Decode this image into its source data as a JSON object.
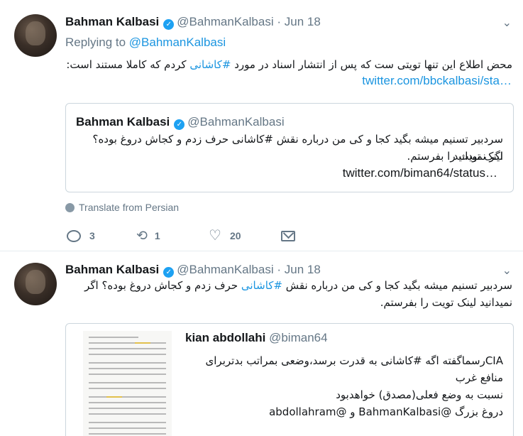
{
  "tweets": [
    {
      "name": "Bahman Kalbasi",
      "handle": "@BahmanKalbasi",
      "separator": "·",
      "date": "Jun 18",
      "replying_label": "Replying to",
      "replying_to": "@BahmanKalbasi",
      "text_before_hashtag": "محض اطلاع این تنها تویتی ست که پس از انتشار اسناد در مورد ",
      "hashtag": "#کاشانی",
      "text_after_hashtag": " کردم که کاملا مستند است:",
      "link": "twitter.com/bbckalbasi/sta…",
      "quote": {
        "name": "Bahman Kalbasi",
        "handle": "@BahmanKalbasi",
        "text_line1": "سردبیر تسنیم میشه بگید کجا و کی من درباره نقش #کاشانی حرف زدم و کجاش دروغ بوده؟ اگر نمیدانید",
        "text_line2": "لینک تویت را بفرستم.",
        "url": "twitter.com/biman64/status…"
      },
      "translate": "Translate from Persian",
      "actions": {
        "replies": "3",
        "retweets": "1",
        "likes": "20"
      }
    },
    {
      "name": "Bahman Kalbasi",
      "handle": "@BahmanKalbasi",
      "separator": "·",
      "date": "Jun 18",
      "text_before_hashtag": "سردبیر تسنیم میشه بگید کجا و کی من درباره نقش ",
      "hashtag": "#کاشانی",
      "text_after_hashtag": " حرف زدم و کجاش دروغ بوده؟ اگر نمیدانید لینک تویت را بفرستم.",
      "quote": {
        "name": "kian abdollahi",
        "handle": "@biman64",
        "text_line1": "CIAرسماگفته اگه #کاشانی به قدرت برسد،وضعی بمراتب بدتربرای منافع غرب",
        "text_line2": "نسبت به وضع فعلی(مصدق) خواهدبود",
        "text_line3": "دروغ بزرگ @BahmanKalbasi و @abdollahram"
      }
    }
  ],
  "colors": {
    "link": "#1b95e0",
    "muted": "#657786",
    "verified": "#1da1f2",
    "border": "#ccd6dd"
  },
  "icons": [
    "chevron-down-icon",
    "verified-icon",
    "globe-icon",
    "reply-icon",
    "retweet-icon",
    "like-icon",
    "message-icon"
  ]
}
